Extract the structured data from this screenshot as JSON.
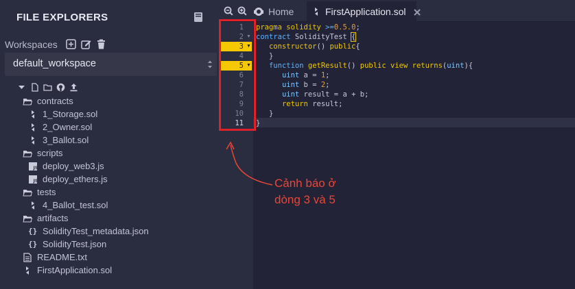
{
  "sidebar": {
    "title": "FILE EXPLORERS",
    "workspaces_label": "Workspaces",
    "workspace_selected": "default_workspace",
    "tree": [
      {
        "label": "contracts",
        "type": "folder"
      },
      {
        "label": "1_Storage.sol",
        "type": "sol"
      },
      {
        "label": "2_Owner.sol",
        "type": "sol"
      },
      {
        "label": "3_Ballot.sol",
        "type": "sol"
      },
      {
        "label": "scripts",
        "type": "folder"
      },
      {
        "label": "deploy_web3.js",
        "type": "js"
      },
      {
        "label": "deploy_ethers.js",
        "type": "js"
      },
      {
        "label": "tests",
        "type": "folder"
      },
      {
        "label": "4_Ballot_test.sol",
        "type": "sol"
      },
      {
        "label": "artifacts",
        "type": "folder"
      },
      {
        "label": "SolidityTest_metadata.json",
        "type": "json"
      },
      {
        "label": "SolidityTest.json",
        "type": "json"
      },
      {
        "label": "README.txt",
        "type": "txt"
      },
      {
        "label": "FirstApplication.sol",
        "type": "sol"
      }
    ]
  },
  "tabs": {
    "home_label": "Home",
    "file_label": "FirstApplication.sol"
  },
  "editor": {
    "line_numbers": [
      "1",
      "2",
      "3",
      "4",
      "5",
      "6",
      "7",
      "8",
      "9",
      "10",
      "11"
    ],
    "warning_lines": [
      3,
      5
    ],
    "current_line": 11,
    "code": [
      "pragma solidity >=0.5.0;",
      "contract SolidityTest {",
      "   constructor() public{",
      "   }",
      "   function getResult() public view returns(uint){",
      "      uint a = 1;",
      "      uint b = 2;",
      "      uint result = a + b;",
      "      return result;",
      "   }",
      "}"
    ]
  },
  "annotation": {
    "line1": "Cảnh báo ở",
    "line2": "dòng 3 và 5",
    "color": "#e8473a"
  },
  "colors": {
    "warning": "#f5c800",
    "highlight_box": "#e0202a",
    "sidebar_bg": "#2a2c3f",
    "editor_bg": "#222336"
  }
}
